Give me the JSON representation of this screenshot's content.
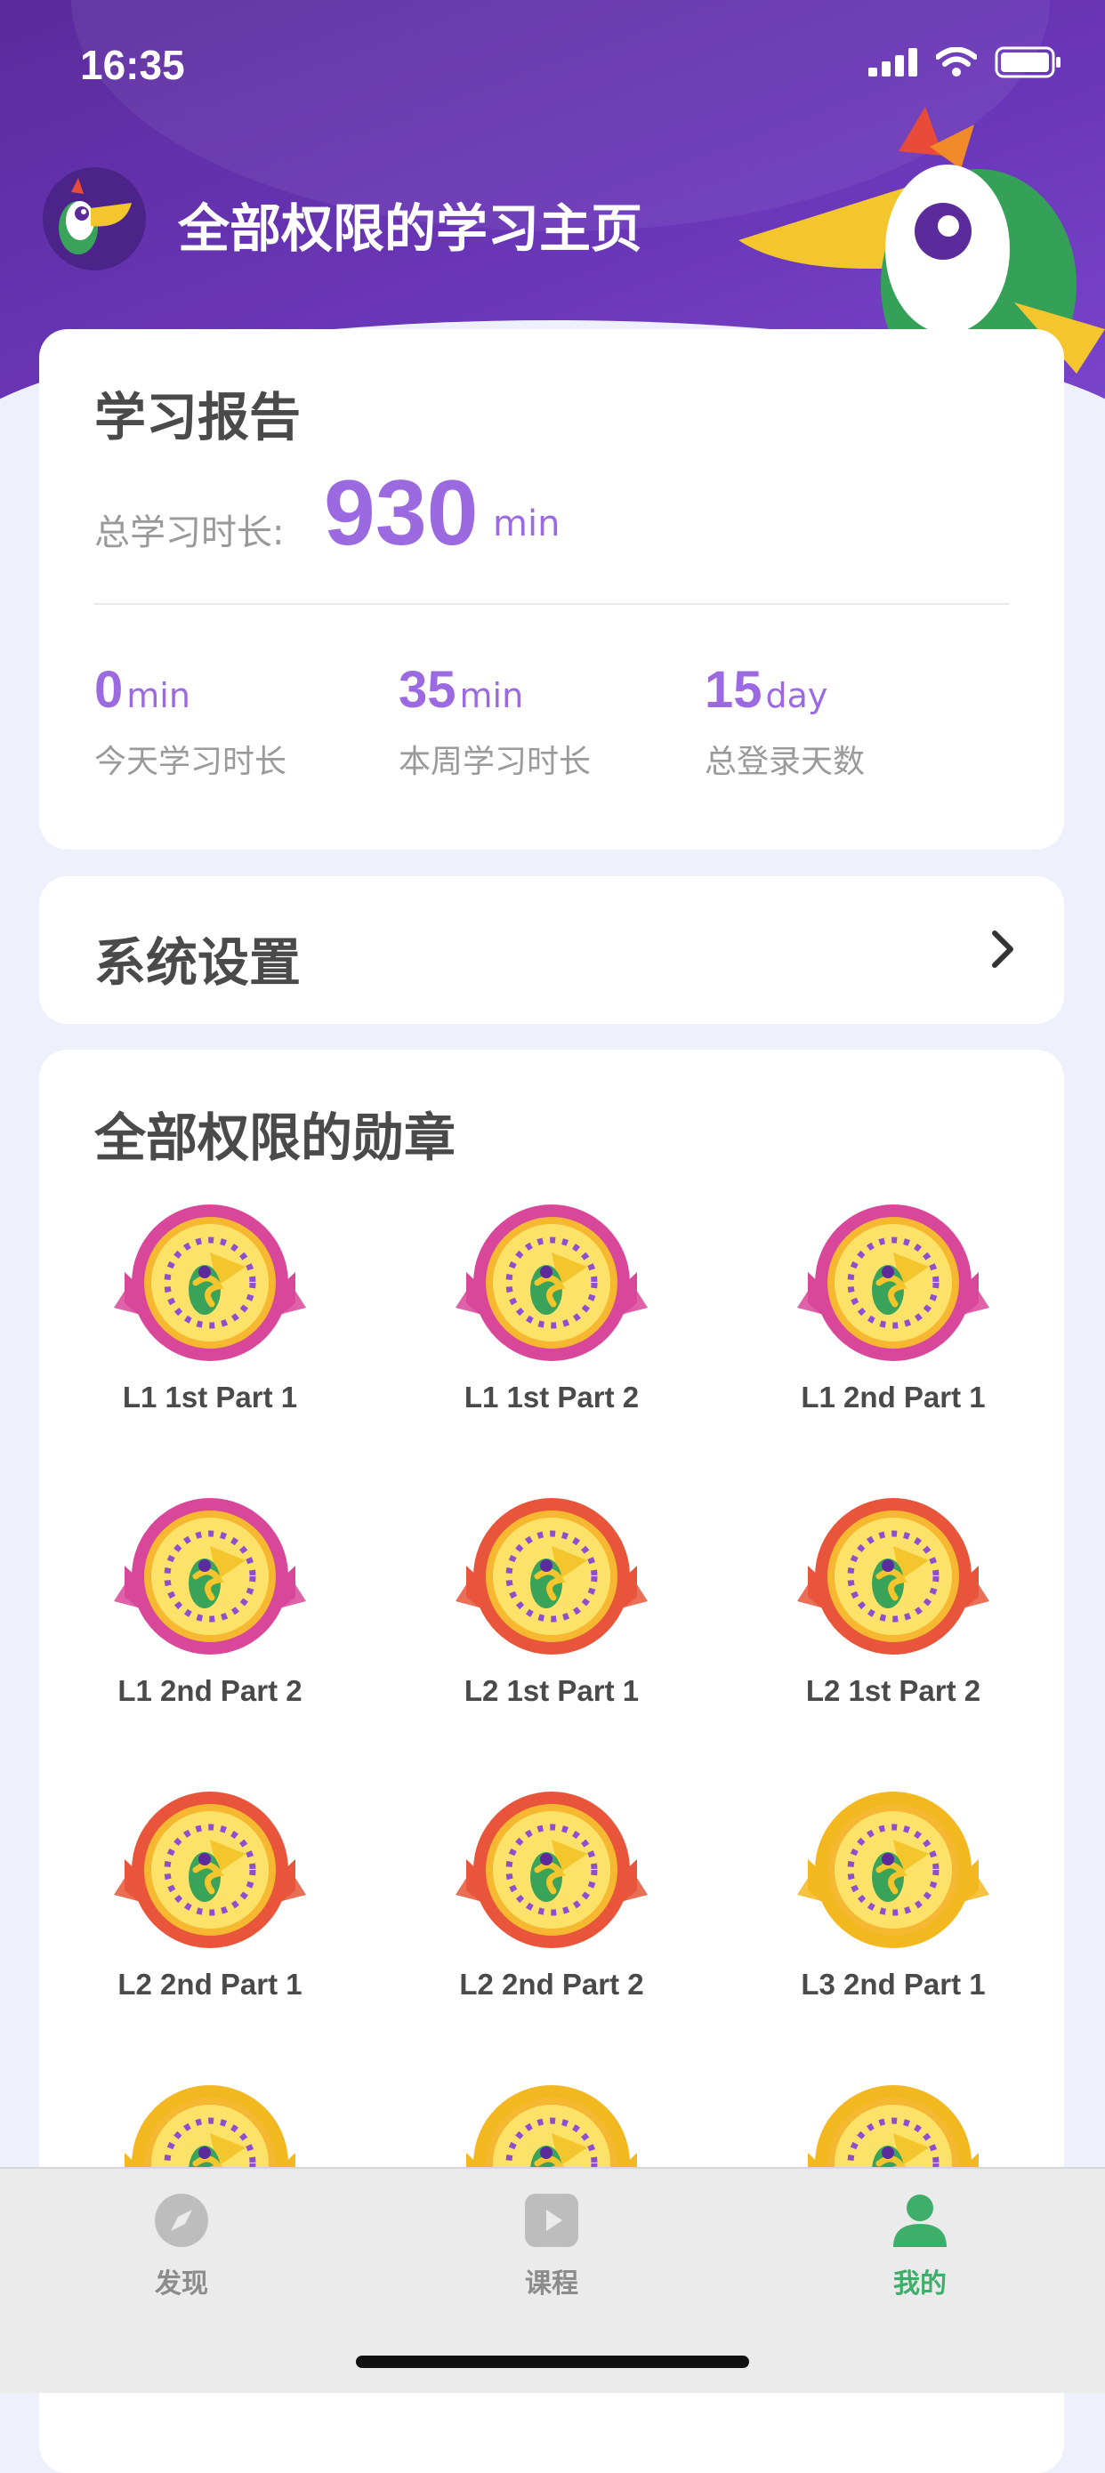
{
  "status_bar": {
    "time": "16:35"
  },
  "header": {
    "title": "全部权限的学习主页"
  },
  "report": {
    "title": "学习报告",
    "total_label": "总学习时长:",
    "total_value": "930",
    "total_unit": "min",
    "stats": [
      {
        "value": "0",
        "unit": "min",
        "label": "今天学习时长"
      },
      {
        "value": "35",
        "unit": "min",
        "label": "本周学习时长"
      },
      {
        "value": "15",
        "unit": "day",
        "label": "总登录天数"
      }
    ]
  },
  "settings": {
    "label": "系统设置"
  },
  "badges": {
    "title": "全部权限的勋章",
    "items": [
      {
        "label": "L1 1st Part 1",
        "color": "#d9479a"
      },
      {
        "label": "L1 1st Part 2",
        "color": "#d9479a"
      },
      {
        "label": "L1 2nd Part 1",
        "color": "#d9479a"
      },
      {
        "label": "L1 2nd Part 2",
        "color": "#d9479a"
      },
      {
        "label": "L2 1st Part 1",
        "color": "#e8553a"
      },
      {
        "label": "L2 1st Part 2",
        "color": "#e8553a"
      },
      {
        "label": "L2 2nd Part 1",
        "color": "#e8553a"
      },
      {
        "label": "L2 2nd Part 2",
        "color": "#e8553a"
      },
      {
        "label": "L3 2nd Part 1",
        "color": "#f3b820"
      },
      {
        "label": "",
        "color": "#f3b820"
      },
      {
        "label": "",
        "color": "#f3b820"
      },
      {
        "label": "",
        "color": "#f3b820"
      }
    ]
  },
  "tabbar": {
    "tabs": [
      {
        "label": "发现",
        "icon": "compass-icon",
        "active": false
      },
      {
        "label": "课程",
        "icon": "play-icon",
        "active": false
      },
      {
        "label": "我的",
        "icon": "person-icon",
        "active": true
      }
    ],
    "active_color": "#3fae6a",
    "inactive_color": "#8c8c8c"
  },
  "colors": {
    "header": "#5b2b9c",
    "accent": "#9c6ae0"
  }
}
